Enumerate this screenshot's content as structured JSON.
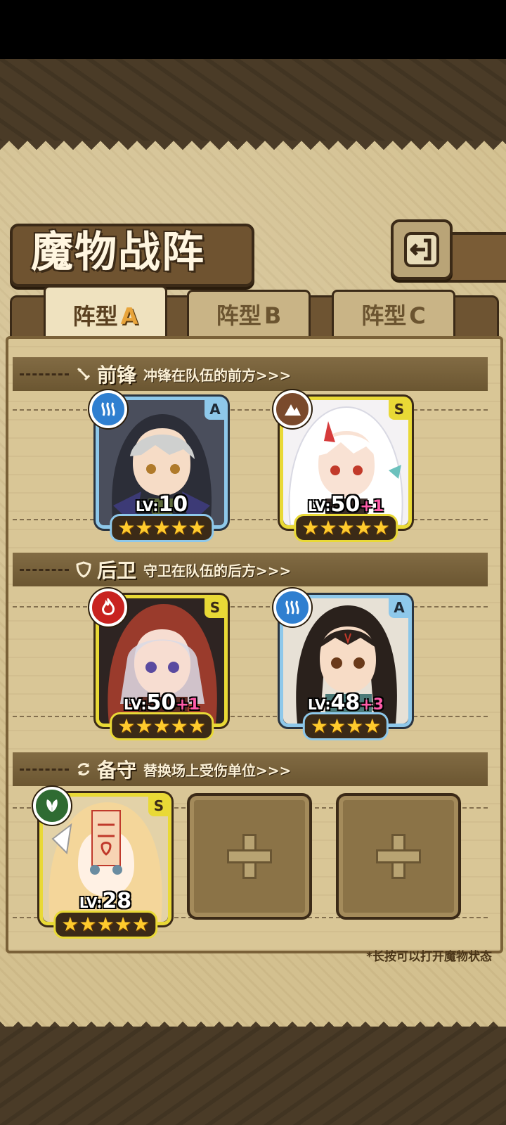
{
  "title": "魔物战阵",
  "tabs": [
    {
      "prefix": "阵型",
      "letter": "A",
      "active": true
    },
    {
      "prefix": "阵型",
      "letter": "B",
      "active": false
    },
    {
      "prefix": "阵型",
      "letter": "C",
      "active": false
    }
  ],
  "sections": {
    "front": {
      "title": "前锋",
      "desc": "冲锋在队伍的前方>>>"
    },
    "back": {
      "title": "后卫",
      "desc": "守卫在队伍的后方>>>"
    },
    "reserve": {
      "title": "备守",
      "desc": "替换场上受伤单位>>>"
    }
  },
  "units": {
    "front1": {
      "rank": "A",
      "element": "water",
      "lv_prefix": "LV:",
      "level": "10",
      "plus": "",
      "stars": "★★★★★"
    },
    "front2": {
      "rank": "S",
      "element": "earth",
      "lv_prefix": "LV:",
      "level": "50",
      "plus": "+1",
      "stars": "★★★★★"
    },
    "back1": {
      "rank": "S",
      "element": "fire",
      "lv_prefix": "LV:",
      "level": "50",
      "plus": "+1",
      "stars": "★★★★★"
    },
    "back2": {
      "rank": "A",
      "element": "water",
      "lv_prefix": "LV:",
      "level": "48",
      "plus": "+3",
      "stars": "★★★★"
    },
    "reserve1": {
      "rank": "S",
      "element": "leaf",
      "lv_prefix": "LV:",
      "level": "28",
      "plus": "",
      "stars": "★★★★★"
    }
  },
  "hint": "*长按可以打开魔物状态",
  "colors": {
    "rank_S": "#e9d936",
    "rank_A": "#8ec8ea",
    "plus_level": "#ff5ca9"
  }
}
